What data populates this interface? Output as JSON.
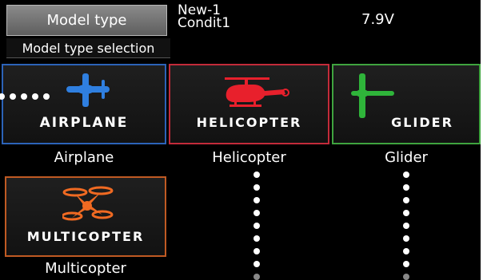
{
  "header": {
    "title": "Model type",
    "model_name": "New-1",
    "condition": "Condit1",
    "voltage": "7.9V"
  },
  "subtitle": "Model type selection",
  "tiles": [
    {
      "id": "airplane",
      "tile_text": "AIRPLANE",
      "caption": "Airplane",
      "icon": "airplane-icon",
      "icon_color": "#2f7fe0",
      "border_color": "#2c63b8"
    },
    {
      "id": "helicopter",
      "tile_text": "HELICOPTER",
      "caption": "Helicopter",
      "icon": "helicopter-icon",
      "icon_color": "#e8202c",
      "border_color": "#c32b3a"
    },
    {
      "id": "glider",
      "tile_text": "GLIDER",
      "caption": "Glider",
      "icon": "glider-icon",
      "icon_color": "#2fb43a",
      "border_color": "#3fa43f"
    },
    {
      "id": "multicopter",
      "tile_text": "MULTICOPTER",
      "caption": "Multicopter",
      "icon": "multicopter-icon",
      "icon_color": "#f06a22",
      "border_color": "#c05a23"
    }
  ]
}
